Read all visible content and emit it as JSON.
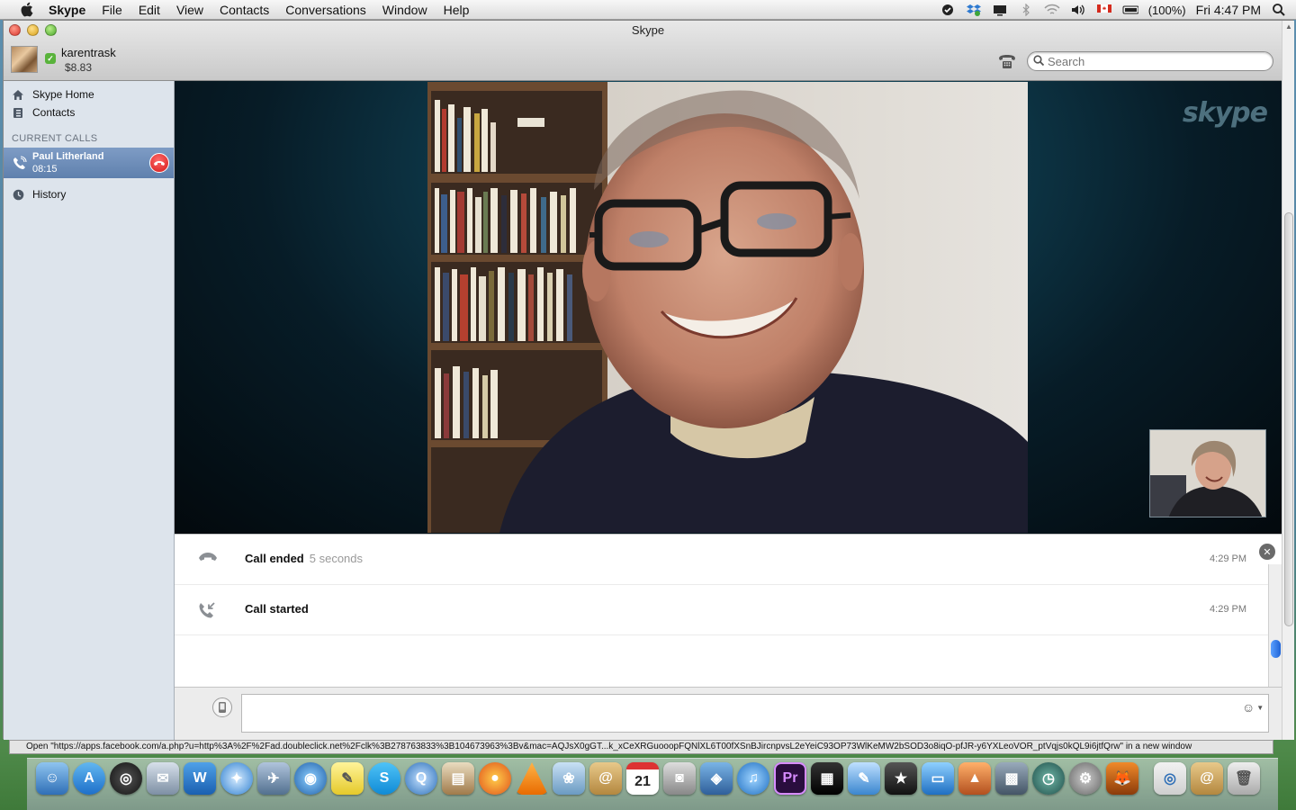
{
  "menubar": {
    "app_name": "Skype",
    "items": [
      "File",
      "Edit",
      "View",
      "Contacts",
      "Conversations",
      "Window",
      "Help"
    ],
    "battery": "(100%)",
    "clock": "Fri 4:47 PM"
  },
  "window": {
    "title": "Skype"
  },
  "profile": {
    "username": "karentrask",
    "credit": "$8.83"
  },
  "search": {
    "placeholder": "Search"
  },
  "sidebar": {
    "items": [
      {
        "label": "Skype Home",
        "icon": "home-icon"
      },
      {
        "label": "Contacts",
        "icon": "contacts-icon"
      }
    ],
    "current_calls_header": "CURRENT CALLS",
    "current_call": {
      "name": "Paul Litherland",
      "duration": "08:15"
    },
    "history_label": "History"
  },
  "video": {
    "watermark": "skype"
  },
  "activity": {
    "rows": [
      {
        "label": "Call ended",
        "duration": "5 seconds",
        "time": "4:29 PM",
        "icon": "phone-hangup-icon"
      },
      {
        "label": "Call started",
        "duration": "",
        "time": "4:29 PM",
        "icon": "incoming-call-icon"
      }
    ]
  },
  "composer": {
    "value": ""
  },
  "statusbar": {
    "text": "Open \"https://apps.facebook.com/a.php?u=http%3A%2F%2Fad.doubleclick.net%2Fclk%3B278763833%3B104673963%3Bv&mac=AQJsX0gGT...k_xCeXRGuooopFQNlXL6T00fXSnBJircnpvsL2eYeiC93OP73WlKeMW2bSOD3o8iqO-pfJR-y6YXLeoVOR_ptVqjs0kQL9i6jtfQrw\" in a new window"
  },
  "colors": {
    "sidebar_bg": "#dde4ec",
    "current_call_bg": "#6a8ab6",
    "hangup_red": "#d41717",
    "status_green": "#59b33b"
  },
  "dock": {
    "icons": [
      "finder-icon",
      "app-store-icon",
      "dashboard-icon",
      "mail-icon",
      "word-icon",
      "safari-icon",
      "xcode-icon",
      "google-earth-icon",
      "stickies-icon",
      "skype-icon",
      "quicktime-icon",
      "preview-icon",
      "firefox-icon",
      "vlc-icon",
      "iphoto-icon",
      "address-book-icon",
      "ical-icon",
      "image-capture-icon",
      "ifileeye-icon",
      "itunes-icon",
      "premiere-icon",
      "clapper-icon",
      "app-icon",
      "imovie-icon",
      "keynote-icon",
      "photo-icon",
      "spaces-icon",
      "time-machine-icon",
      "system-prefs-icon",
      "fox-icon",
      "safari-doc-icon",
      "documents-icon",
      "trash-icon"
    ]
  }
}
